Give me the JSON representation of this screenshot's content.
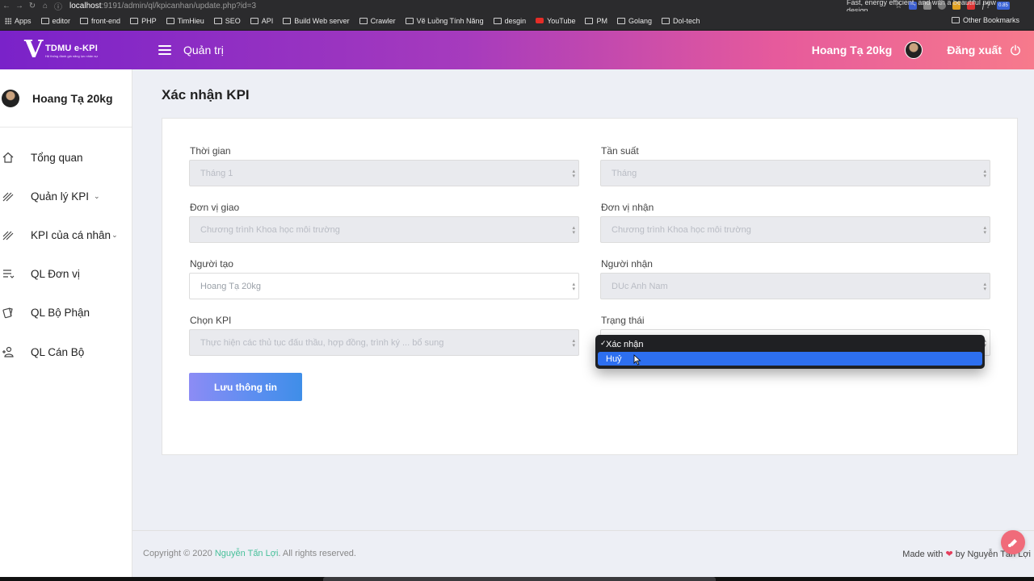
{
  "browser": {
    "url_host": "localhost",
    "url_path": ":9191/admin/ql/kpicanhan/update.php?id=3",
    "promo_text": "Fast, energy efficient, and with a beautiful new design.",
    "badge": "0.85",
    "bookmarks": [
      "Apps",
      "editor",
      "front-end",
      "PHP",
      "TimHieu",
      "SEO",
      "API",
      "Build Web server",
      "Crawler",
      "Vẽ Luồng Tính Năng",
      "desgin",
      "YouTube",
      "PM",
      "Golang",
      "Dol-tech"
    ],
    "other_bookmarks": "Other Bookmarks"
  },
  "header": {
    "logo_text": "TDMU e-KPI",
    "logo_sub": "Hệ thống đánh giá năng lực nhân sự",
    "title": "Quản trị",
    "user": "Hoang Tạ 20kg",
    "logout": "Đăng xuất"
  },
  "sidebar": {
    "user": "Hoang Tạ 20kg",
    "items": [
      {
        "label": "Tổng quan",
        "icon": "home-icon"
      },
      {
        "label": "Quản lý KPI",
        "icon": "stripes-icon",
        "chevron": "⌄"
      },
      {
        "label": "KPI của cá nhân",
        "icon": "stripes-icon",
        "chevron": "⌄"
      },
      {
        "label": "QL Đơn vị",
        "icon": "list-icon"
      },
      {
        "label": "QL Bộ Phận",
        "icon": "cards-icon"
      },
      {
        "label": "QL Cán Bộ",
        "icon": "user-add-icon"
      }
    ]
  },
  "page": {
    "title": "Xác nhận KPI"
  },
  "form": {
    "thoi_gian": {
      "label": "Thời gian",
      "value": "Tháng 1"
    },
    "tan_suat": {
      "label": "Tần suất",
      "value": "Tháng"
    },
    "don_vi_giao": {
      "label": "Đơn vị giao",
      "value": "Chương trình Khoa học môi trường"
    },
    "don_vi_nhan": {
      "label": "Đơn vị nhận",
      "value": "Chương trình Khoa học môi trường"
    },
    "nguoi_tao": {
      "label": "Người tạo",
      "value": "Hoang Tạ 20kg"
    },
    "nguoi_nhan": {
      "label": "Người nhận",
      "value": "DUc Anh Nam"
    },
    "chon_kpi": {
      "label": "Chọn KPI",
      "value": "Thực hiện các thủ tục đấu thầu, hợp đồng, trình ký ... bổ sung"
    },
    "trang_thai": {
      "label": "Trạng thái",
      "options": [
        "Xác nhận",
        "Huỷ"
      ],
      "selected": "Xác nhận",
      "highlighted": "Huỷ"
    },
    "save_label": "Lưu thông tin"
  },
  "footer": {
    "copyright_prefix": "Copyright © 2020 ",
    "author": "Nguyễn Tấn Lợi",
    "copyright_suffix": ". All rights reserved.",
    "made_with": "Made with",
    "heart": "❤",
    "by": "by Nguyễn Tấn Lợi"
  },
  "colors": {
    "header_gradient": [
      "#7a22c9",
      "#a63bbd",
      "#e65a9c",
      "#f77a8c"
    ],
    "accent_link": "#48c09a",
    "button_gradient": [
      "#8c8cf5",
      "#3f8ee8"
    ],
    "dropdown_highlight": "#2d6ff0"
  }
}
